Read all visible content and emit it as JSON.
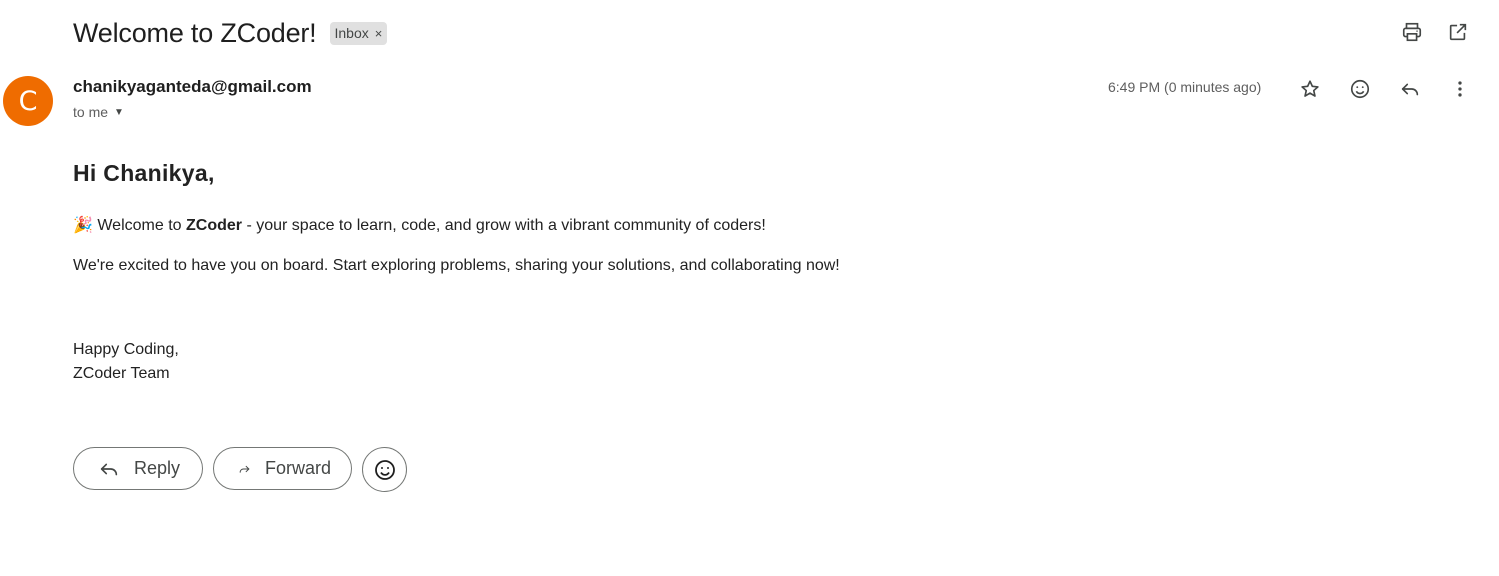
{
  "subject": "Welcome to ZCoder!",
  "label_chip": {
    "text": "Inbox",
    "remove": "×"
  },
  "top_actions": {
    "print_icon": "print-icon",
    "open_new_window_icon": "open-in-new-icon"
  },
  "sender": {
    "avatar_letter": "C",
    "avatar_color": "#ef6c00",
    "email": "chanikyaganteda@gmail.com",
    "to_label": "to me",
    "timestamp": "6:49 PM (0 minutes ago)"
  },
  "message_actions": [
    "star-icon",
    "emoji-reaction-icon",
    "reply-icon",
    "more-vert-icon"
  ],
  "body": {
    "greeting": "Hi Chanikya,",
    "line1_emoji": "🎉",
    "line1_prefix": " Welcome to ",
    "line1_bold": "ZCoder",
    "line1_suffix": " - your space to learn, code, and grow with a vibrant community of coders!",
    "line2": "We're excited to have you on board. Start exploring problems, sharing your solutions, and collaborating now!",
    "signoff_line1": "Happy Coding,",
    "signoff_line2": "ZCoder Team"
  },
  "bottom_actions": {
    "reply_label": "Reply",
    "forward_label": "Forward"
  }
}
